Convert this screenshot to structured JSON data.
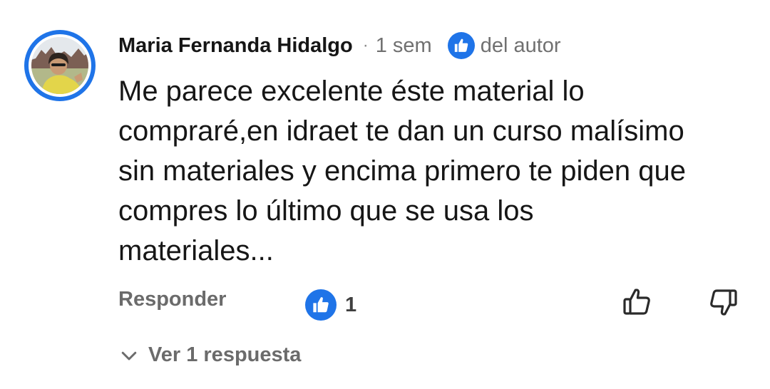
{
  "comment": {
    "author": "Maria Fernanda Hidalgo",
    "separator": "·",
    "time": "1 sem",
    "author_badge_icon": "thumbs-up-badge-icon",
    "author_tag": "del autor",
    "text": "Me parece excelente éste material lo\ncompraré,en idraet te dan un curso malísimo\nsin materiales y encima primero te piden que\ncompres lo último que se usa los\nmateriales...",
    "reply_label": "Responder",
    "like_count": "1",
    "view_replies_label": "Ver 1 respuesta"
  },
  "icons": {
    "like_button": "thumbs-up-outline-icon",
    "dislike_button": "thumbs-down-outline-icon",
    "expand": "chevron-down-icon"
  },
  "colors": {
    "accent_blue": "#1f74e8",
    "text_primary": "#161616",
    "text_secondary": "#707070"
  }
}
